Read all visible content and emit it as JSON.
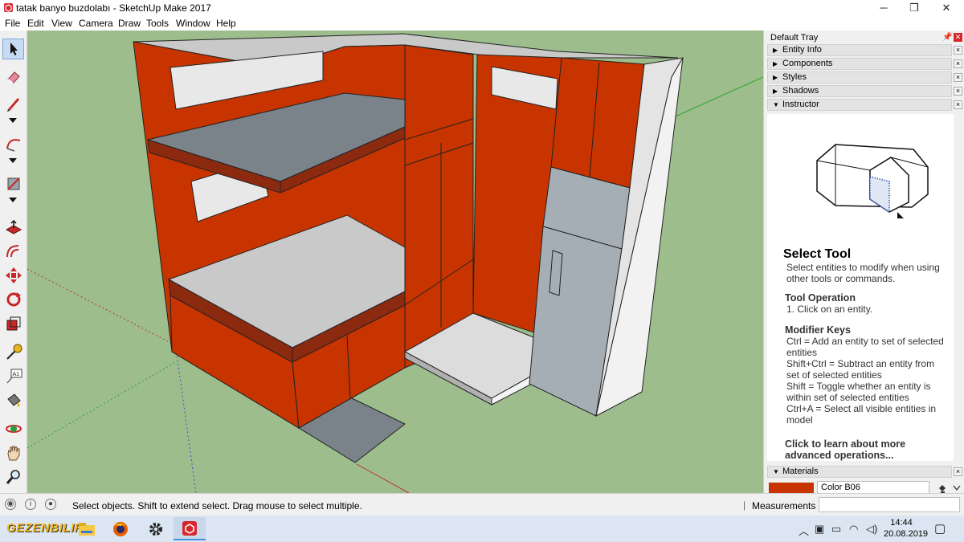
{
  "window": {
    "title": "tatak banyo buzdolabı - SketchUp Make 2017",
    "app_icon": "sketchup-icon",
    "controls": [
      "minimize-icon",
      "maximize-icon",
      "close-icon"
    ]
  },
  "menu": {
    "items": [
      "File",
      "Edit",
      "View",
      "Camera",
      "Draw",
      "Tools",
      "Window",
      "Help"
    ]
  },
  "toolbar": {
    "tools": [
      "select-icon",
      "eraser-icon",
      "pencil-icon",
      "arc-icon",
      "rectangle-icon",
      "push-pull-icon",
      "offset-icon",
      "move-icon",
      "rotate-icon",
      "scale-icon",
      "tape-measure-icon",
      "text-icon",
      "paint-bucket-icon",
      "orbit-icon",
      "pan-icon",
      "zoom-icon"
    ],
    "text_tool_label": "A1"
  },
  "colors": {
    "ground": "#9dbd8d",
    "sky": "#ffffff",
    "wall_red": "#c73400",
    "wall_red_dark": "#8c2a10",
    "shelf_grey": "#7a8389",
    "floor_light": "#c9c9c9",
    "fridge_blue": "#a5aeb5",
    "side_white": "#e4e4e4"
  },
  "tray": {
    "title": "Default Tray",
    "panels": [
      {
        "label": "Entity Info",
        "expanded": false
      },
      {
        "label": "Components",
        "expanded": false
      },
      {
        "label": "Styles",
        "expanded": false
      },
      {
        "label": "Shadows",
        "expanded": false
      },
      {
        "label": "Instructor",
        "expanded": true
      }
    ],
    "instructor": {
      "title": "Select Tool",
      "description": "Select entities to modify when using other tools or commands.",
      "operation_heading": "Tool Operation",
      "operation_step": "1. Click on an entity.",
      "modifier_heading": "Modifier Keys",
      "modifiers": [
        "Ctrl = Add an entity to set of selected entities",
        "Shift+Ctrl = Subtract an entity from set of selected entities",
        "Shift = Toggle whether an entity is within set of selected entities",
        "Ctrl+A = Select all visible entities in model"
      ],
      "learn_more": "Click to learn about more advanced operations..."
    },
    "materials": {
      "label": "Materials",
      "expanded": true,
      "current": "Color B06",
      "swatch": "#c73400"
    }
  },
  "status": {
    "hint": "Select objects. Shift to extend select. Drag mouse to select multiple.",
    "measurements_label": "Measurements",
    "measurements_value": ""
  },
  "taskbar": {
    "brand": "GEZENBILIR",
    "apps": [
      "file-explorer-icon",
      "firefox-icon",
      "settings-icon",
      "sketchup-icon"
    ],
    "tray_icons": [
      "chevron-up-icon",
      "network-icon",
      "battery-icon",
      "wifi-icon",
      "volume-icon"
    ],
    "time": "14:44",
    "date": "20.08.2019"
  }
}
